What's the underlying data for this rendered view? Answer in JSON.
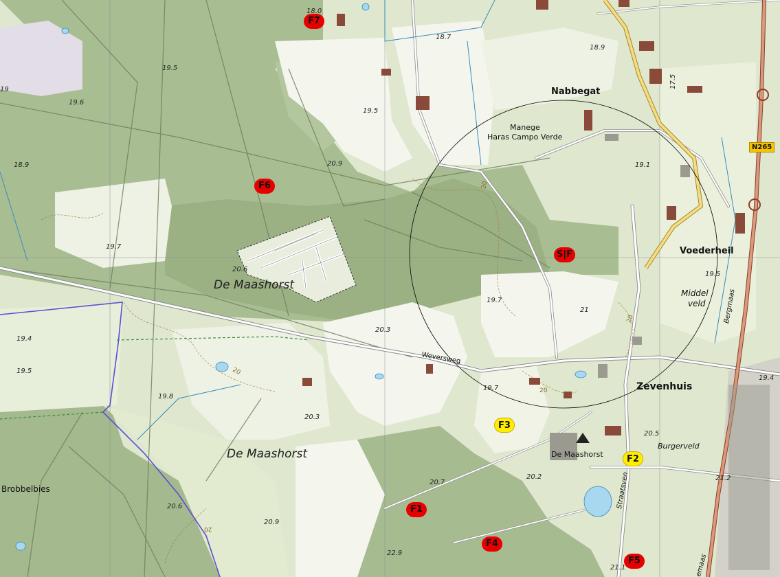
{
  "map": {
    "places": {
      "nabbegat": "Nabbegat",
      "voederheil": "Voederheil",
      "zevenhuis": "Zevenhuis",
      "de_maashorst_village": "De Maashorst",
      "burgerveld": "Burgerveld",
      "manege_line1": "Manege",
      "manege_line2": "Haras Campo Verde",
      "middelveld_line1": "Middel",
      "middelveld_line2": "veld",
      "brobbelbies": "Brobbelbies"
    },
    "areas": {
      "maashorst_north": "De Maashorst",
      "maashorst_south": "De Maashorst"
    },
    "roads": {
      "weversweg": "Weversweg",
      "bergmaas": "Bergmaas",
      "straatsven": "Straatsven",
      "emaas": "emaas",
      "n265": "N265"
    },
    "elevations": [
      "18.0",
      "18.7",
      "18.9",
      "19.5",
      "19.6",
      "19",
      "18.9",
      "19.5",
      "20.9",
      "19.7",
      "20.6",
      "19.1",
      "17.5",
      "19.5",
      "19.7",
      "20.3",
      "19.4",
      "19.5",
      "19.8",
      "20.3",
      "21",
      "19.7",
      "19.4",
      "20.5",
      "20.2",
      "20.7",
      "21.2",
      "20.6",
      "20.9",
      "22.9",
      "21.1"
    ],
    "contour_labels": [
      "20",
      "20",
      "20",
      "20",
      "20"
    ],
    "markers": [
      {
        "label": "F7",
        "color": "red"
      },
      {
        "label": "F6",
        "color": "red"
      },
      {
        "label": "S|F",
        "color": "red"
      },
      {
        "label": "F3",
        "color": "yellow"
      },
      {
        "label": "F2",
        "color": "yellow"
      },
      {
        "label": "F1",
        "color": "red"
      },
      {
        "label": "F4",
        "color": "red"
      },
      {
        "label": "F5",
        "color": "red"
      }
    ],
    "colors": {
      "forest": "#9fb58a",
      "forest_light": "#b9cba2",
      "field": "#f4f6ee",
      "meadow": "#d8e4c6",
      "marker_red": "#e80000",
      "marker_yellow": "#ffee00",
      "circle": "#000000",
      "boundary": "#5a4fd0",
      "main_road": "#c98a6a",
      "minor_road": "#ffffff",
      "water": "#a8d8f0"
    }
  }
}
